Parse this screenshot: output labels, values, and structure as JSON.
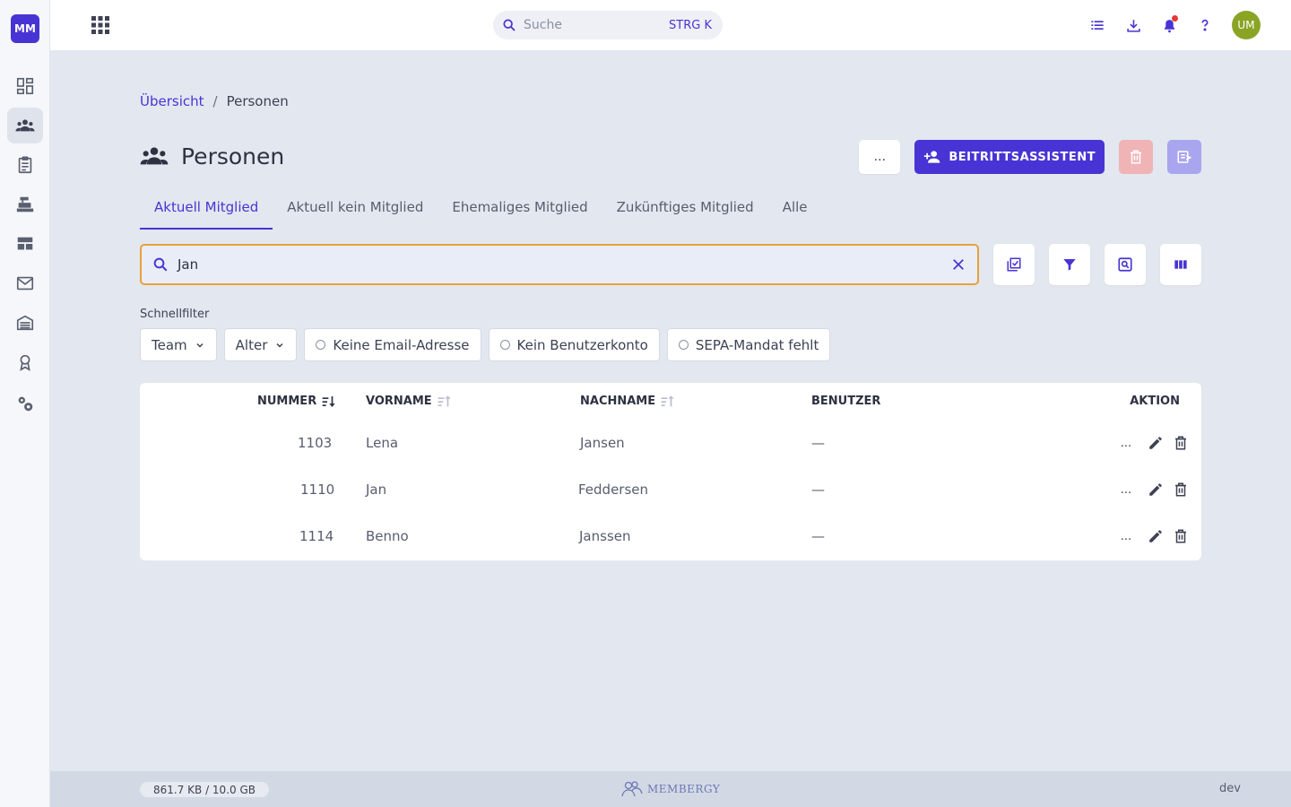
{
  "org": {
    "initials": "MM"
  },
  "topbar": {
    "search_placeholder": "Suche",
    "search_shortcut": "STRG K",
    "avatar_initials": "UM"
  },
  "breadcrumb": {
    "root": "Übersicht",
    "separator": "/",
    "current": "Personen"
  },
  "page": {
    "title": "Personen",
    "more_label": "...",
    "primary_label": "BEITRITTSASSISTENT"
  },
  "tabs": [
    "Aktuell Mitglied",
    "Aktuell kein Mitglied",
    "Ehemaliges Mitglied",
    "Zukünftiges Mitglied",
    "Alle"
  ],
  "search": {
    "value": "Jan"
  },
  "quickfilter": {
    "label": "Schnellfilter",
    "dropdowns": [
      "Team",
      "Alter"
    ],
    "toggles": [
      "Keine Email-Adresse",
      "Kein Benutzerkonto",
      "SEPA-Mandat fehlt"
    ]
  },
  "table": {
    "headers": {
      "nummer": "NUMMER",
      "vorname": "VORNAME",
      "nachname": "NACHNAME",
      "benutzer": "BENUTZER",
      "aktion": "AKTION"
    },
    "rows": [
      {
        "nummer": "1103",
        "vorname": "Lena",
        "nachname": "Jansen",
        "benutzer": "—",
        "more": "..."
      },
      {
        "nummer": "1110",
        "vorname": "Jan",
        "nachname": "Feddersen",
        "benutzer": "—",
        "more": "..."
      },
      {
        "nummer": "1114",
        "vorname": "Benno",
        "nachname": "Janssen",
        "benutzer": "—",
        "more": "..."
      }
    ]
  },
  "footer": {
    "storage": "861.7 KB / 10.0 GB",
    "brand": "MEMBERGY",
    "env": "dev"
  },
  "colors": {
    "accent": "#4834d4",
    "focus_border": "#e8a13a",
    "avatar": "#8aa424",
    "notification": "#e53935"
  }
}
